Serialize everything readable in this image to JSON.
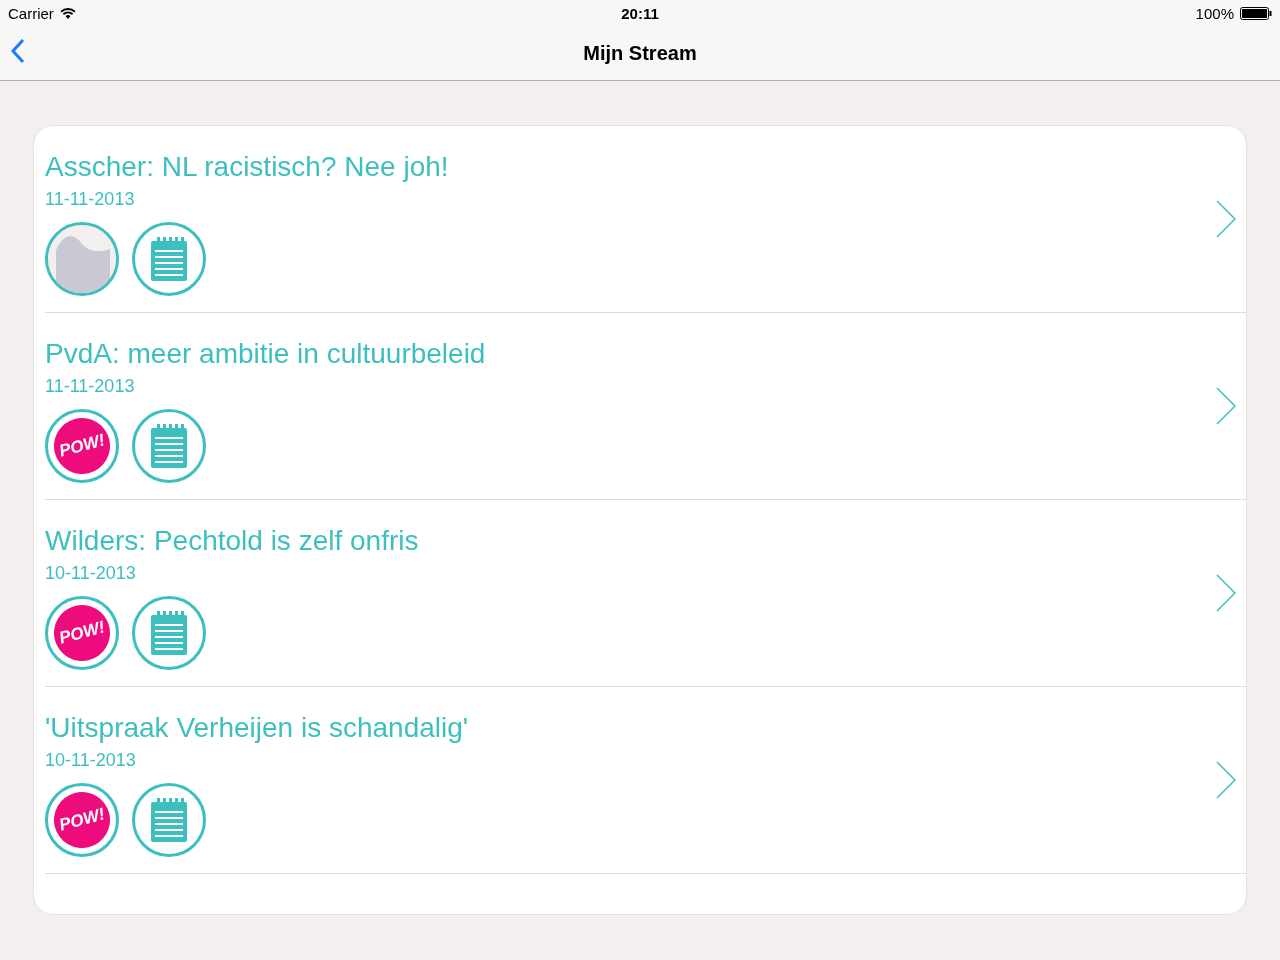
{
  "status_bar": {
    "carrier": "Carrier",
    "time": "20:11",
    "battery": "100%"
  },
  "nav": {
    "title": "Mijn Stream"
  },
  "items": [
    {
      "title": "Asscher: NL racistisch? Nee joh!",
      "date": "11-11-2013",
      "media": [
        {
          "kind": "photo"
        },
        {
          "kind": "notes"
        }
      ]
    },
    {
      "title": "PvdA: meer ambitie in cultuurbeleid",
      "date": "11-11-2013",
      "media": [
        {
          "kind": "pow",
          "label": "POW!"
        },
        {
          "kind": "notes"
        }
      ]
    },
    {
      "title": "Wilders: Pechtold is zelf onfris",
      "date": "10-11-2013",
      "media": [
        {
          "kind": "pow",
          "label": "POW!"
        },
        {
          "kind": "notes"
        }
      ]
    },
    {
      "title": "'Uitspraak Verheijen is schandalig'",
      "date": "10-11-2013",
      "media": [
        {
          "kind": "pow",
          "label": "POW!"
        },
        {
          "kind": "notes"
        }
      ]
    }
  ]
}
